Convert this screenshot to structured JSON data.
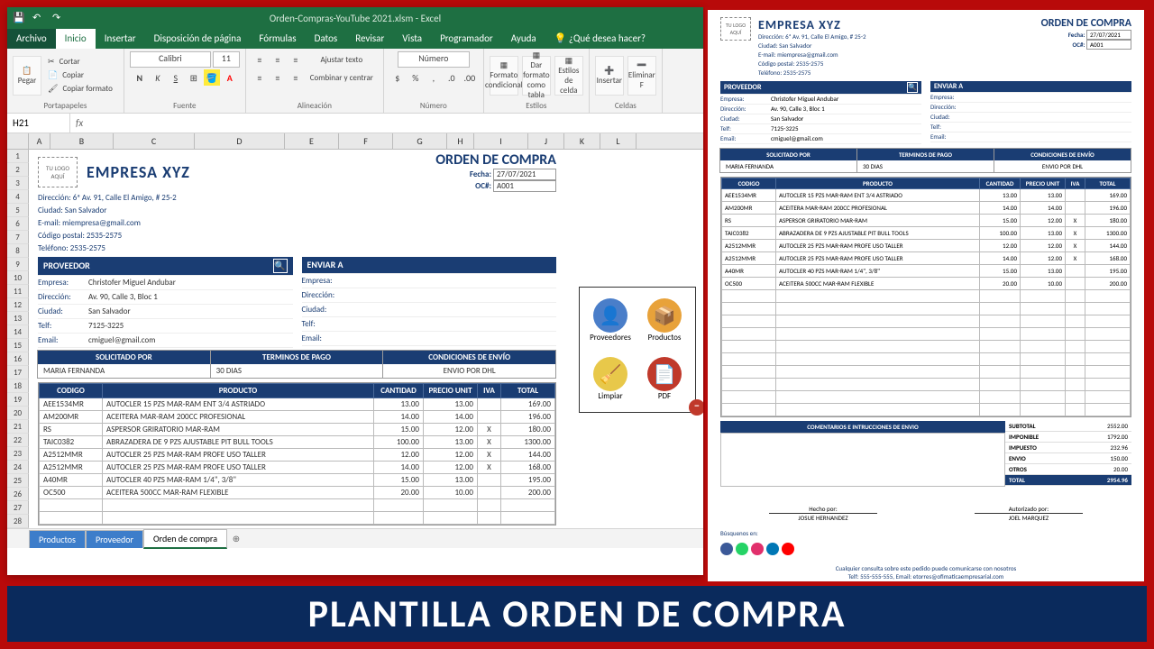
{
  "titlebar": {
    "filename": "Orden-Compras-YouTube 2021.xlsm - Excel"
  },
  "ribbon": {
    "tabs": [
      "Archivo",
      "Inicio",
      "Insertar",
      "Disposición de página",
      "Fórmulas",
      "Datos",
      "Revisar",
      "Vista",
      "Programador",
      "Ayuda"
    ],
    "tell_me": "¿Qué desea hacer?",
    "clipboard": {
      "paste": "Pegar",
      "cut": "Cortar",
      "copy": "Copiar",
      "format": "Copiar formato",
      "label": "Portapapeles"
    },
    "font": {
      "name": "Calibri",
      "size": "11",
      "label": "Fuente"
    },
    "align": {
      "wrap": "Ajustar texto",
      "merge": "Combinar y centrar",
      "label": "Alineación"
    },
    "number": {
      "format": "Número",
      "label": "Número"
    },
    "styles": {
      "cond": "Formato condicional",
      "table": "Dar formato como tabla",
      "cell": "Estilos de celda",
      "label": "Estilos"
    },
    "cells": {
      "insert": "Insertar",
      "delete": "Eliminar F",
      "label": "Celdas"
    }
  },
  "namebox": "H21",
  "company": {
    "logo_text": "TU LOGO AQUÍ",
    "name": "EMPRESA XYZ",
    "address": "Dirección: 6ª Av. 91, Calle El Amigo, # 25-2",
    "city": "Ciudad: San Salvador",
    "email": "E-mail: miempresa@gmail.com",
    "postal": "Código postal: 2535-2575",
    "phone": "Teléfono: 2535-2575"
  },
  "po": {
    "title": "ORDEN DE COMPRA",
    "date_lbl": "Fecha:",
    "date": "27/07/2021",
    "oc_lbl": "OC#:",
    "oc": "A001"
  },
  "proveedor": {
    "header": "PROVEEDOR",
    "empresa_lbl": "Empresa:",
    "empresa": "Christofer Miguel Andubar",
    "dir_lbl": "Dirección:",
    "dir": "Av. 90, Calle 3, Bloc 1",
    "ciudad_lbl": "Ciudad:",
    "ciudad": "San Salvador",
    "tel_lbl": "Telf:",
    "tel": "7125-3225",
    "email_lbl": "Email:",
    "email": "cmiguel@gmail.com"
  },
  "enviar": {
    "header": "ENVIAR A",
    "empresa_lbl": "Empresa:",
    "dir_lbl": "Dirección:",
    "ciudad_lbl": "Ciudad:",
    "tel_lbl": "Telf:",
    "email_lbl": "Email:"
  },
  "terms": {
    "solicitado_hdr": "SOLICITADO POR",
    "solicitado": "MARIA FERNANDA",
    "pago_hdr": "TERMINOS DE PAGO",
    "pago": "30 DIAS",
    "envio_hdr": "CONDICIONES DE ENVÍO",
    "envio": "ENVIO POR DHL"
  },
  "items": {
    "headers": [
      "CODIGO",
      "PRODUCTO",
      "CANTIDAD",
      "PRECIO UNIT",
      "IVA",
      "TOTAL"
    ],
    "rows": [
      {
        "codigo": "AEE1534MR",
        "producto": "AUTOCLER 15 PZS MAR-RAM ENT 3/4 ASTRIADO",
        "cant": "13.00",
        "precio": "13.00",
        "iva": "",
        "total": "169.00"
      },
      {
        "codigo": "AM200MR",
        "producto": "ACEITERA MAR-RAM 200CC PROFESIONAL",
        "cant": "14.00",
        "precio": "14.00",
        "iva": "",
        "total": "196.00"
      },
      {
        "codigo": "RS",
        "producto": "ASPERSOR GRIRATORIO MAR-RAM",
        "cant": "15.00",
        "precio": "12.00",
        "iva": "X",
        "total": "180.00"
      },
      {
        "codigo": "TAIC0382",
        "producto": "ABRAZADERA DE 9 PZS AJUSTABLE PIT BULL TOOLS",
        "cant": "100.00",
        "precio": "13.00",
        "iva": "X",
        "total": "1300.00"
      },
      {
        "codigo": "A2512MMR",
        "producto": "AUTOCLER 25 PZS MAR-RAM PROFE USO TALLER",
        "cant": "12.00",
        "precio": "12.00",
        "iva": "X",
        "total": "144.00"
      },
      {
        "codigo": "A2512MMR",
        "producto": "AUTOCLER 25 PZS MAR-RAM PROFE USO TALLER",
        "cant": "14.00",
        "precio": "12.00",
        "iva": "X",
        "total": "168.00"
      },
      {
        "codigo": "A40MR",
        "producto": "AUTOCLER 40 PZS MAR-RAM 1/4\", 3/8\"",
        "cant": "15.00",
        "precio": "13.00",
        "iva": "",
        "total": "195.00"
      },
      {
        "codigo": "OC500",
        "producto": "ACEITERA 500CC MAR-RAM FLEXIBLE",
        "cant": "20.00",
        "precio": "10.00",
        "iva": "",
        "total": "200.00"
      }
    ]
  },
  "macros": {
    "prov": "Proveedores",
    "prod": "Productos",
    "clean": "Limpiar",
    "pdf": "PDF"
  },
  "sheets": [
    "Productos",
    "Proveedor",
    "Orden de compra"
  ],
  "preview": {
    "comments_hdr": "COMENTARIOS E INTRUCCIONES DE ENVIO",
    "totals": {
      "subtotal_lbl": "SUBTOTAL",
      "subtotal": "2552.00",
      "imponible_lbl": "IMPONIBLE",
      "imponible": "1792.00",
      "impuesto_lbl": "IMPUESTO",
      "impuesto": "232.96",
      "envio_lbl": "ENVIO",
      "envio": "150.00",
      "otros_lbl": "OTROS",
      "otros": "20.00",
      "total_lbl": "TOTAL",
      "total": "2954.96"
    },
    "sig": {
      "hecho_lbl": "Hecho por:",
      "hecho": "JOSUE HERNANDEZ",
      "auth_lbl": "Autorizado por:",
      "auth": "JOEL MARQUEZ"
    },
    "search_lbl": "Búsquenos en:",
    "footer1": "Cualquier consulta sobre este pedido puede comunicarse con nosotros",
    "footer2": "Telf: 555-555-555, Email: etorres@ofimaticaempresarial.com"
  },
  "banner": "PLANTILLA ORDEN DE COMPRA"
}
